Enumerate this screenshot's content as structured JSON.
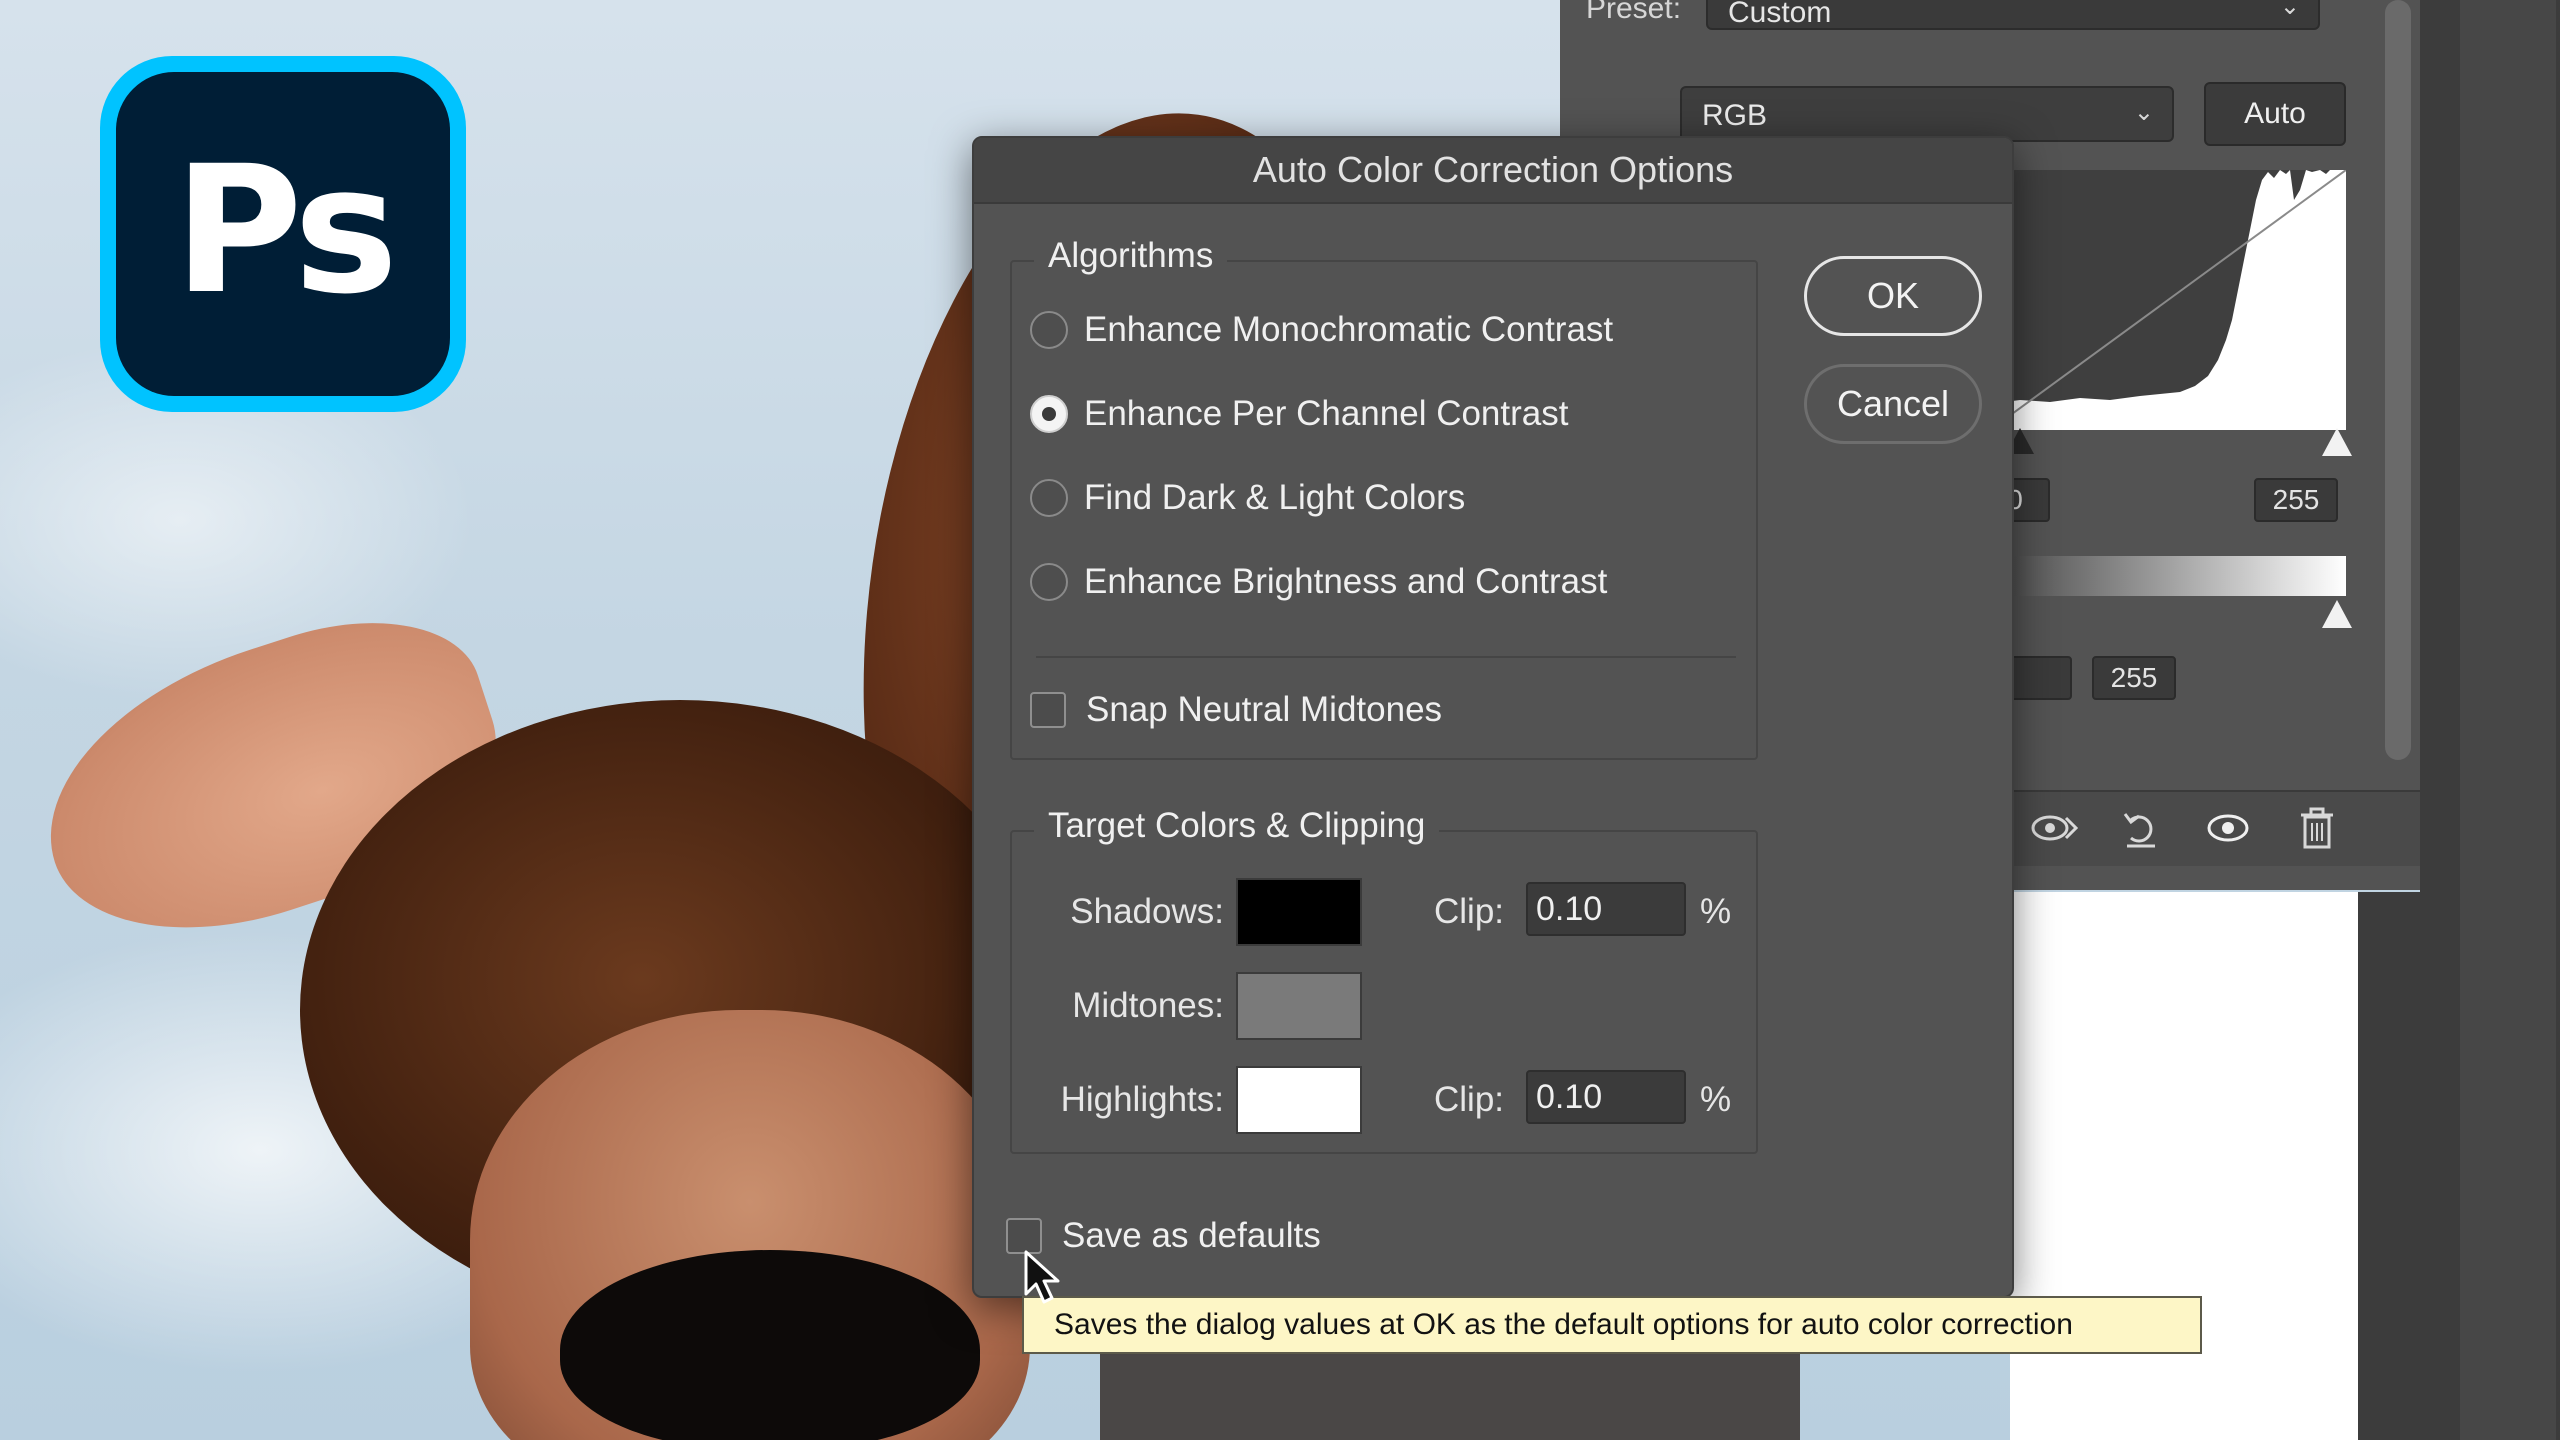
{
  "logo": {
    "text": "Ps",
    "colors": {
      "ring": "#00c3ff",
      "fill": "#001e36"
    }
  },
  "curves_panel": {
    "preset_label": "Preset:",
    "preset_value": "Custom",
    "channel": "RGB",
    "auto_label": "Auto",
    "input_black": "0",
    "input_white": "255",
    "output_white": "255",
    "footer_icons": [
      "view-previous-icon",
      "reset-icon",
      "visibility-icon",
      "trash-icon"
    ]
  },
  "dialog": {
    "title": "Auto Color Correction Options",
    "algorithms_title": "Algorithms",
    "algorithms": [
      {
        "label": "Enhance Monochromatic Contrast",
        "checked": false
      },
      {
        "label": "Enhance Per Channel Contrast",
        "checked": true
      },
      {
        "label": "Find Dark & Light Colors",
        "checked": false
      },
      {
        "label": "Enhance Brightness and Contrast",
        "checked": false
      }
    ],
    "snap_label": "Snap Neutral Midtones",
    "snap_checked": false,
    "ok_label": "OK",
    "cancel_label": "Cancel",
    "target_title": "Target Colors & Clipping",
    "shadows_label": "Shadows:",
    "midtones_label": "Midtones:",
    "highlights_label": "Highlights:",
    "clip_label": "Clip:",
    "shadows_clip": "0.10",
    "highlights_clip": "0.10",
    "percent": "%",
    "swatch_colors": {
      "shadows": "#000000",
      "midtones": "#7a7a7a",
      "highlights": "#ffffff"
    },
    "save_defaults_label": "Save as defaults",
    "save_defaults_checked": false
  },
  "tooltip": "Saves the dialog values at OK as the default options for auto color correction"
}
